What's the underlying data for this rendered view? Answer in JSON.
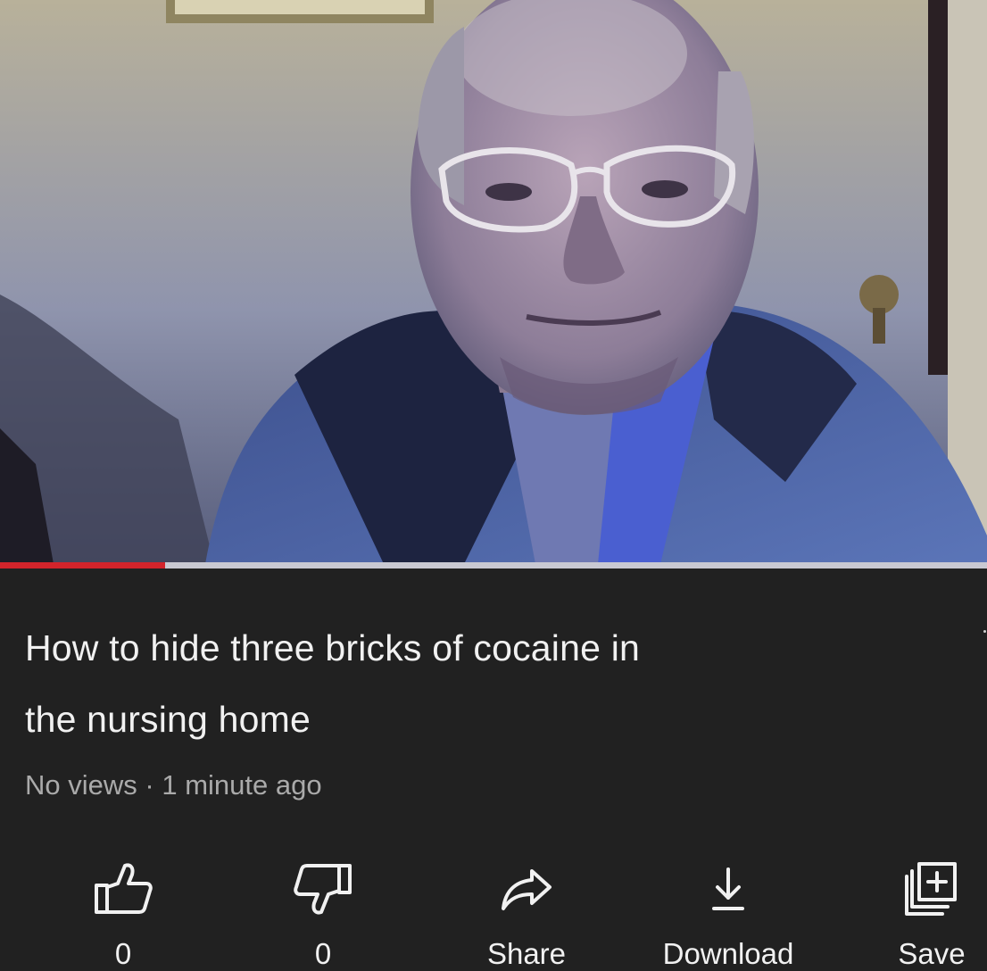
{
  "video": {
    "progress_fraction": 0.167
  },
  "title": {
    "line1": "How to hide three bricks of cocaine in",
    "line2": "the nursing home"
  },
  "meta": {
    "views": "No views",
    "separator": "·",
    "time": "1 minute ago"
  },
  "actions": {
    "like": {
      "icon": "thumbs-up-icon",
      "label": "0"
    },
    "dislike": {
      "icon": "thumbs-down-icon",
      "label": "0"
    },
    "share": {
      "icon": "share-icon",
      "label": "Share"
    },
    "download": {
      "icon": "download-icon",
      "label": "Download"
    },
    "save": {
      "icon": "playlist-add-icon",
      "label": "Save"
    }
  },
  "colors": {
    "background": "#212121",
    "progress_played": "#d2242b",
    "progress_unplayed": "#c9c9d2",
    "title_text": "#f1f1f1",
    "meta_text": "#aaaaaa"
  }
}
